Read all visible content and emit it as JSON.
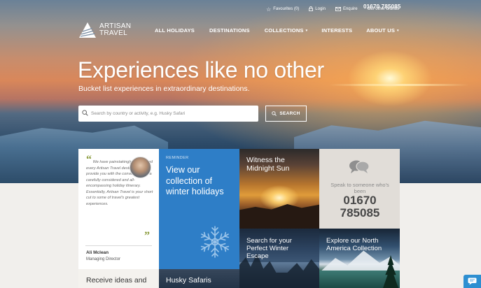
{
  "brand": {
    "line1": "ARTISAN",
    "line2": "TRAVEL"
  },
  "utility": {
    "favourites": "Favourites (0)",
    "login": "Login",
    "enquire": "Enquire",
    "other_brands": "Our other brands",
    "phone": "01670 785085"
  },
  "nav": {
    "items": [
      {
        "label": "ALL HOLIDAYS"
      },
      {
        "label": "DESTINATIONS"
      },
      {
        "label": "COLLECTIONS",
        "caret": "▾"
      },
      {
        "label": "INTERESTS"
      },
      {
        "label": "ABOUT US",
        "caret": "▾"
      }
    ]
  },
  "hero": {
    "headline": "Experiences like no other",
    "subheadline": "Bucket list experiences in extraordinary destinations.",
    "search_placeholder": "Search by country or activity, e.g. Husky Safari",
    "search_button": "SEARCH"
  },
  "tiles": {
    "quote": {
      "text": "We have painstakingly researched every Artisan Travel destination to provide you with the convenience of a carefully considered and all-encompassing holiday itinerary. Essentially, Artisan Travel is your short cut to some of travel's greatest experiences.",
      "name": "Ali Mclean",
      "role": "Managing Director"
    },
    "receive": "Receive ideas and",
    "reminder": {
      "label": "REMINDER",
      "title": "View our collection of winter holidays"
    },
    "husky": "Husky Safaris",
    "midnight": "Witness the Midnight Sun",
    "winter_escape": "Search for your Perfect Winter Escape",
    "speak": {
      "text": "Speak to someone who's been",
      "phone": "01670 785085"
    },
    "america": "Explore our North America Collection"
  },
  "colors": {
    "accent_blue": "#2e7ec7",
    "quote_green": "#8a9b3c",
    "speak_bg": "#e1ddd8"
  }
}
